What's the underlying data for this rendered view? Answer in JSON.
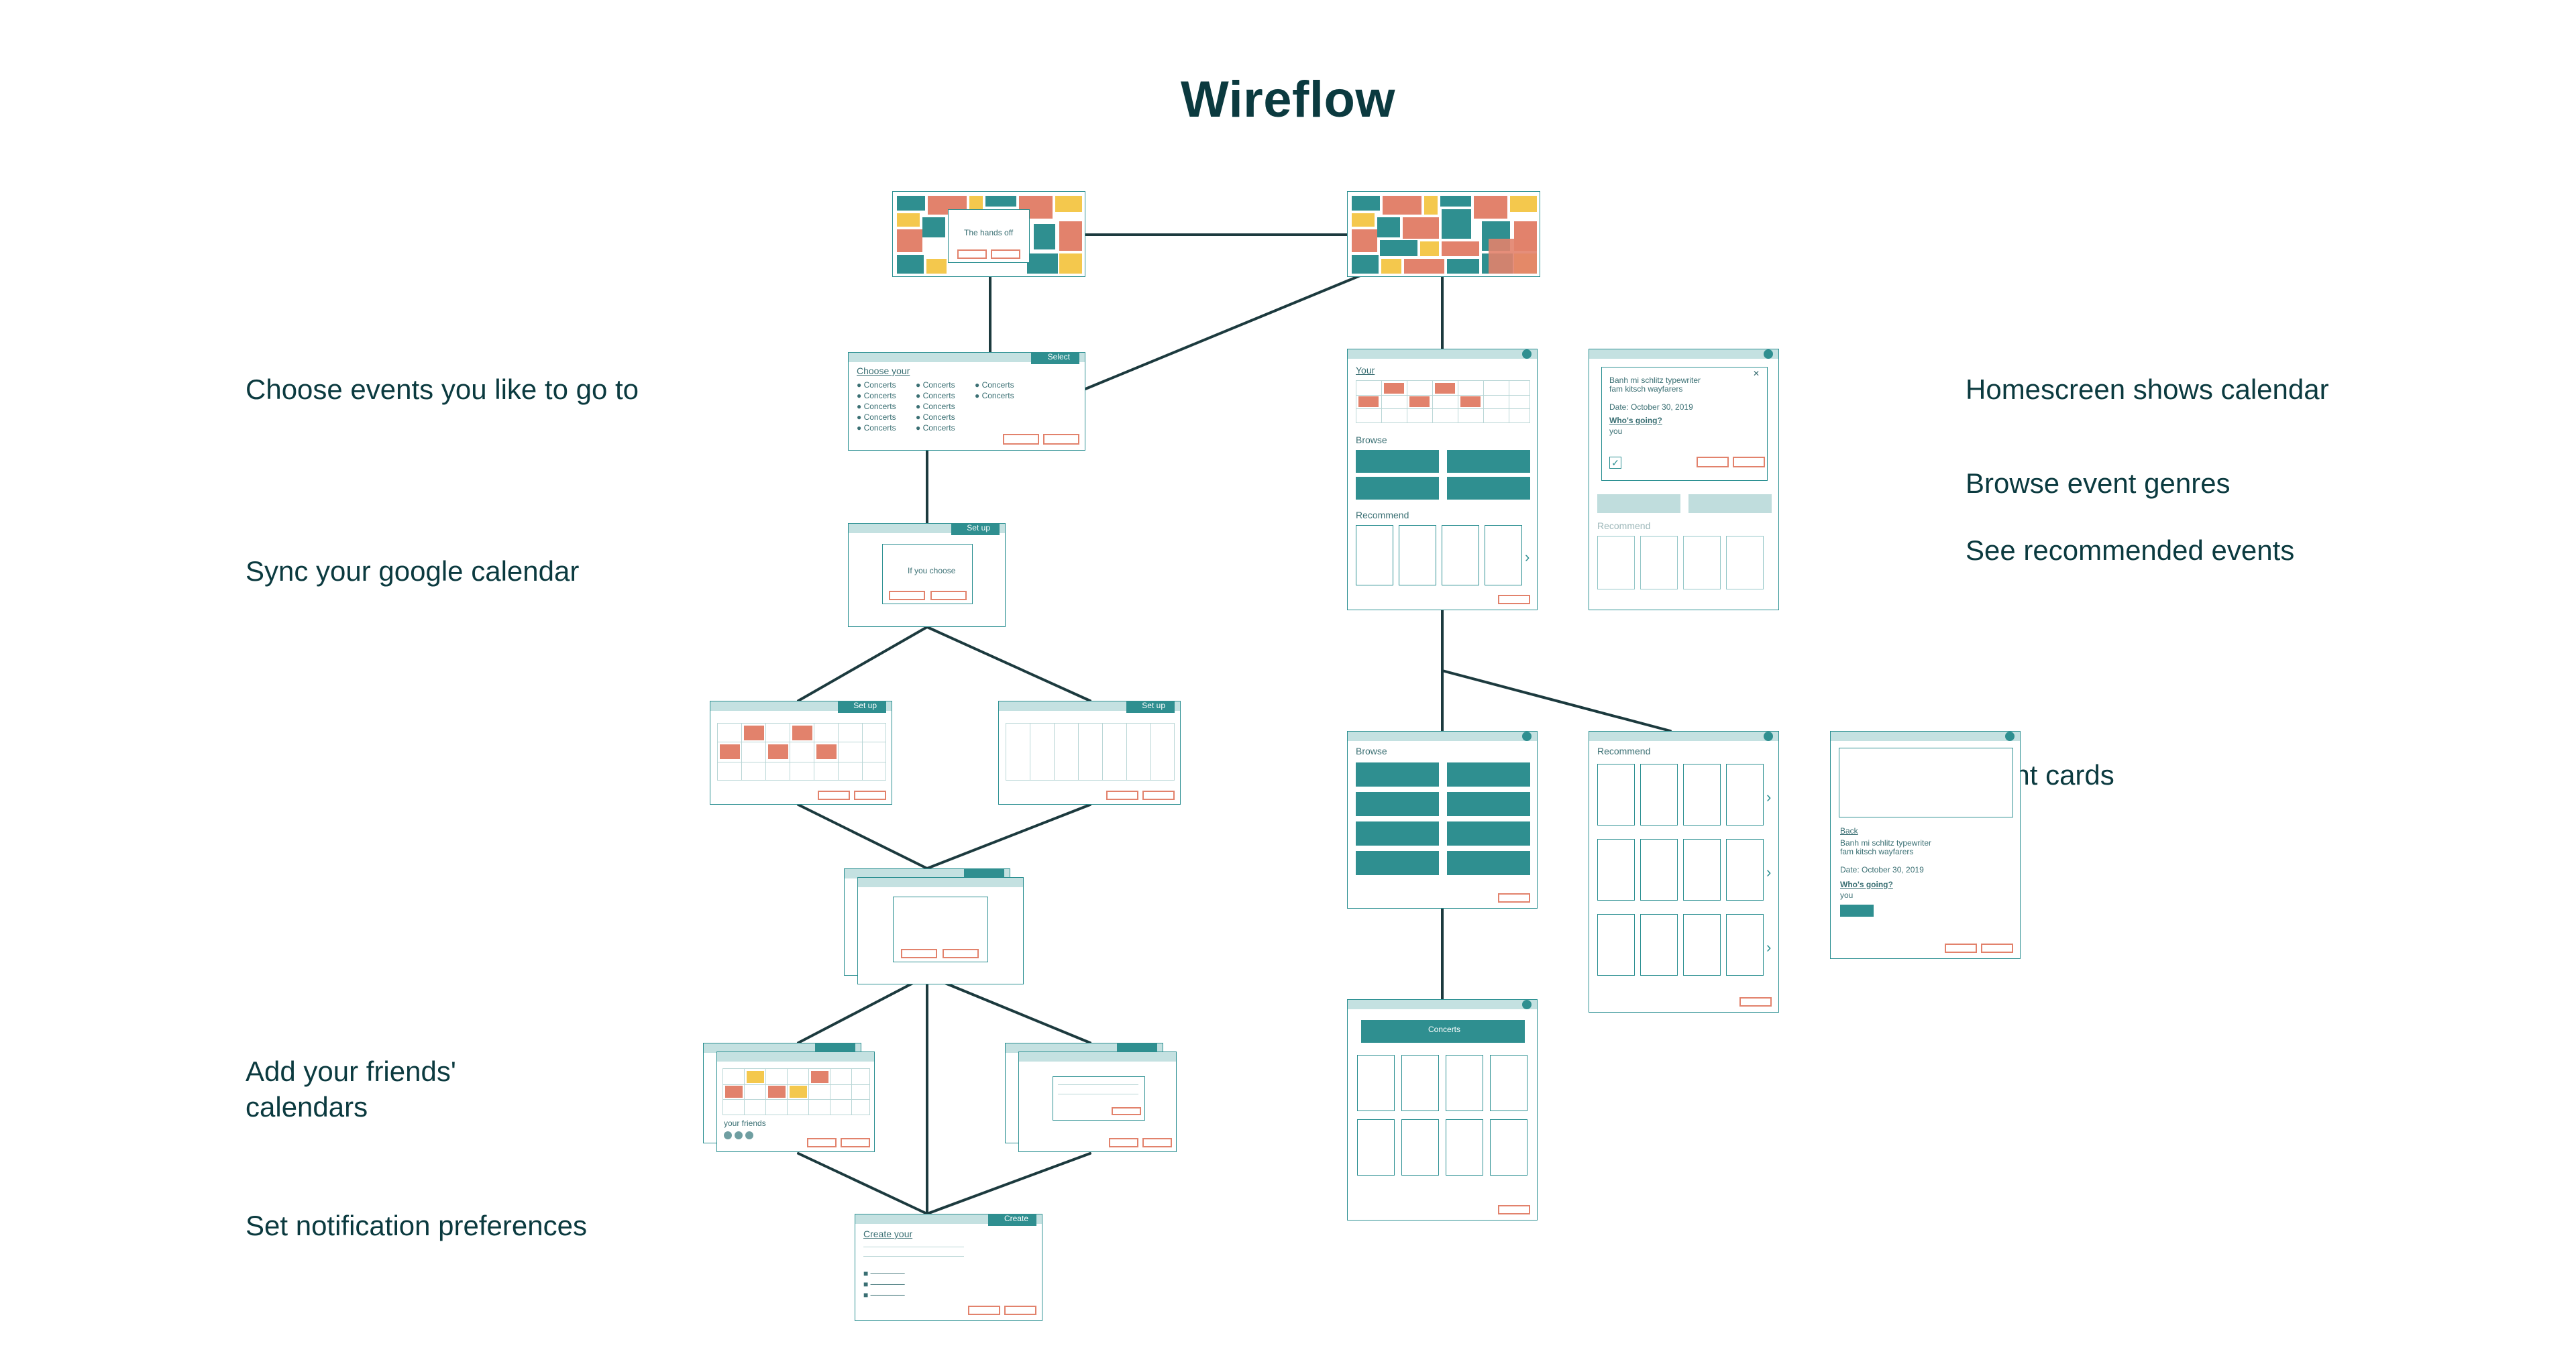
{
  "title": "Wireflow",
  "annotations": {
    "chooseEvents": "Choose events you like to go to",
    "syncCalendar": "Sync your google calendar",
    "addFriends": "Add your friends'\ncalendars",
    "setNotifications": "Set notification preferences",
    "homescreen": "Homescreen shows calendar",
    "browseGenres": "Browse event genres",
    "seeRecommended": "See recommended events",
    "eventCards": "Event cards"
  },
  "thumbLabels": {
    "popup1": "The hands off",
    "chooseHeader": "Choose your",
    "chooseItem": "Concerts",
    "select": "Select",
    "setup": "Set up",
    "create": "Create",
    "ifYouChoose": "If you choose",
    "yourFriends": "your friends",
    "your": "Your",
    "browse": "Browse",
    "recommend": "Recommend",
    "concerts": "Concerts",
    "eventTitle": "Banh mi schlitz typewriter\nfam kitsch wayfarers",
    "date": "Date: October 30, 2019",
    "whosGoing": "Who's going?",
    "you": "you",
    "back": "Back",
    "createYour": "Create your"
  },
  "colors": {
    "teal": "#2f8f90",
    "tealLight": "#c4e1e1",
    "salmon": "#e2826c",
    "yellow": "#f4c84d",
    "dark": "#0b3a3f"
  }
}
